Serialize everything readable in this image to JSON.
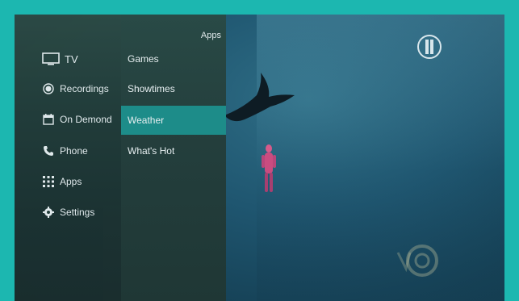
{
  "sidebar": {
    "items": [
      {
        "label": "TV",
        "icon": "tv-icon"
      },
      {
        "label": "Recordings",
        "icon": "record-icon"
      },
      {
        "label": "On Demond",
        "icon": "calendar-icon"
      },
      {
        "label": "Phone",
        "icon": "phone-icon"
      },
      {
        "label": "Apps",
        "icon": "grid-icon"
      },
      {
        "label": "Settings",
        "icon": "gear-icon"
      }
    ]
  },
  "submenu": {
    "title": "Apps",
    "items": [
      {
        "label": "Games"
      },
      {
        "label": "Showtimes"
      },
      {
        "label": "Weather",
        "selected": true
      },
      {
        "label": "What's Hot"
      }
    ]
  },
  "colors": {
    "frame": "#1cb7b0",
    "highlight": "#1d8c89"
  }
}
